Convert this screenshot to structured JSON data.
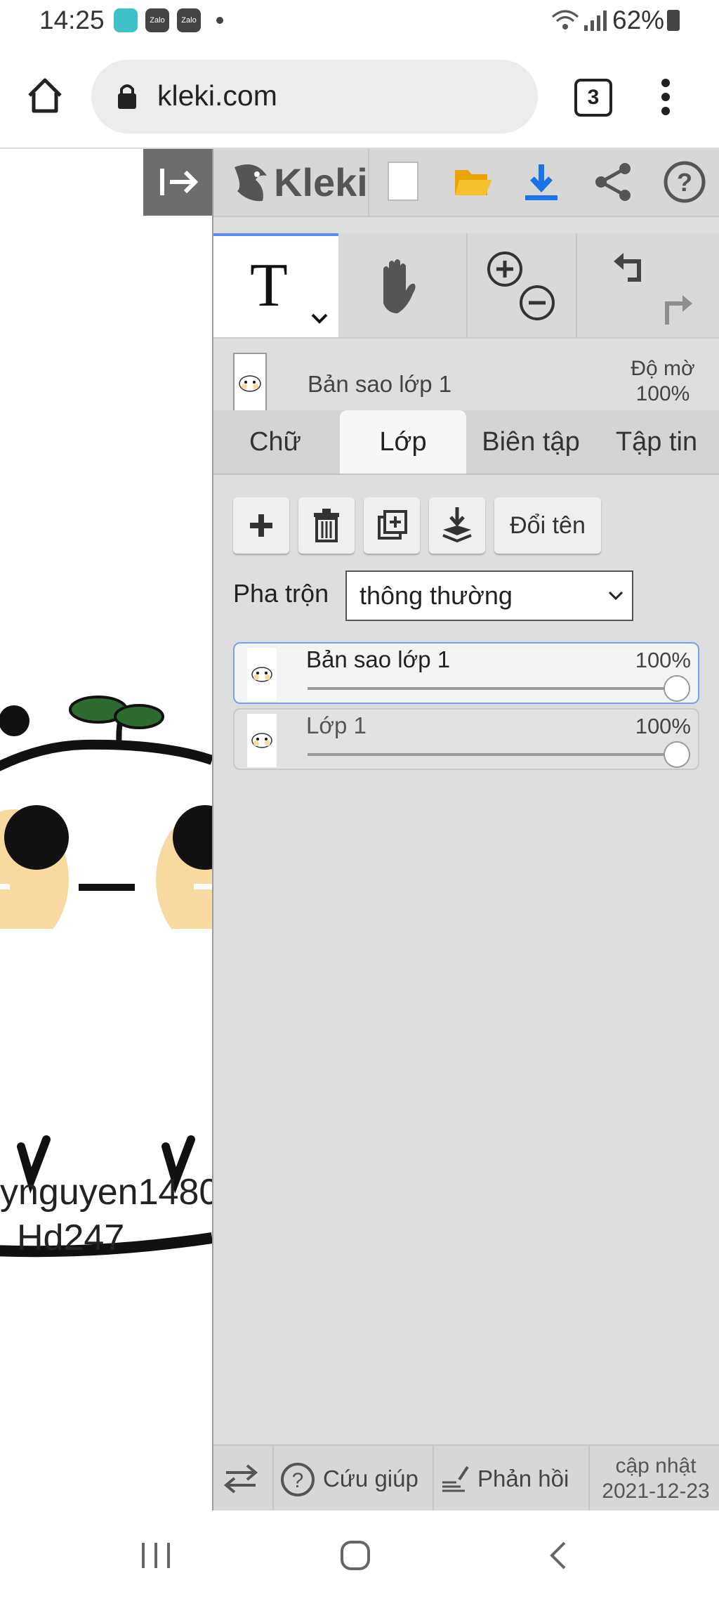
{
  "status_bar": {
    "time": "14:25",
    "notification_icons": [
      "messenger-icon",
      "zalo-icon",
      "zalo-icon",
      "dot-icon"
    ],
    "battery": "62%"
  },
  "browser": {
    "url": "kleki.com",
    "tab_count": "3"
  },
  "canvas": {
    "text_line1": "ynguyen1480",
    "text_line2": "Hd247"
  },
  "app": {
    "logo": "Kleki",
    "top_icons": [
      "new-image-icon",
      "open-folder-icon",
      "download-icon",
      "share-icon",
      "help-icon"
    ]
  },
  "toolbar": {
    "active_tool": "T",
    "tools": [
      "text-tool-icon",
      "hand-tool-icon",
      "zoom-in-icon",
      "zoom-out-icon",
      "undo-icon",
      "redo-icon"
    ]
  },
  "current_layer": {
    "name": "Bản sao lớp 1",
    "opacity_label": "Độ mờ",
    "opacity_value": "100%"
  },
  "tabs": [
    {
      "label": "Chữ"
    },
    {
      "label": "Lớp"
    },
    {
      "label": "Biên tập"
    },
    {
      "label": "Tập tin"
    }
  ],
  "layer_panel": {
    "rename_label": "Đổi tên",
    "blend_label": "Pha trộn",
    "blend_value": "thông thường",
    "layers": [
      {
        "name": "Bản sao lớp 1",
        "opacity": "100%",
        "opacity_value": 1.0,
        "selected": true
      },
      {
        "name": "Lớp 1",
        "opacity": "100%",
        "opacity_value": 1.0,
        "selected": false
      }
    ]
  },
  "bottom_bar": {
    "help_label": "Cứu giúp",
    "feedback_label": "Phản hồi",
    "update_label": "cập nhật",
    "update_date": "2021-12-23"
  },
  "colors": {
    "accent": "#5b8def",
    "download_blue": "#1a73e8",
    "folder_yellow": "#f5b900"
  }
}
